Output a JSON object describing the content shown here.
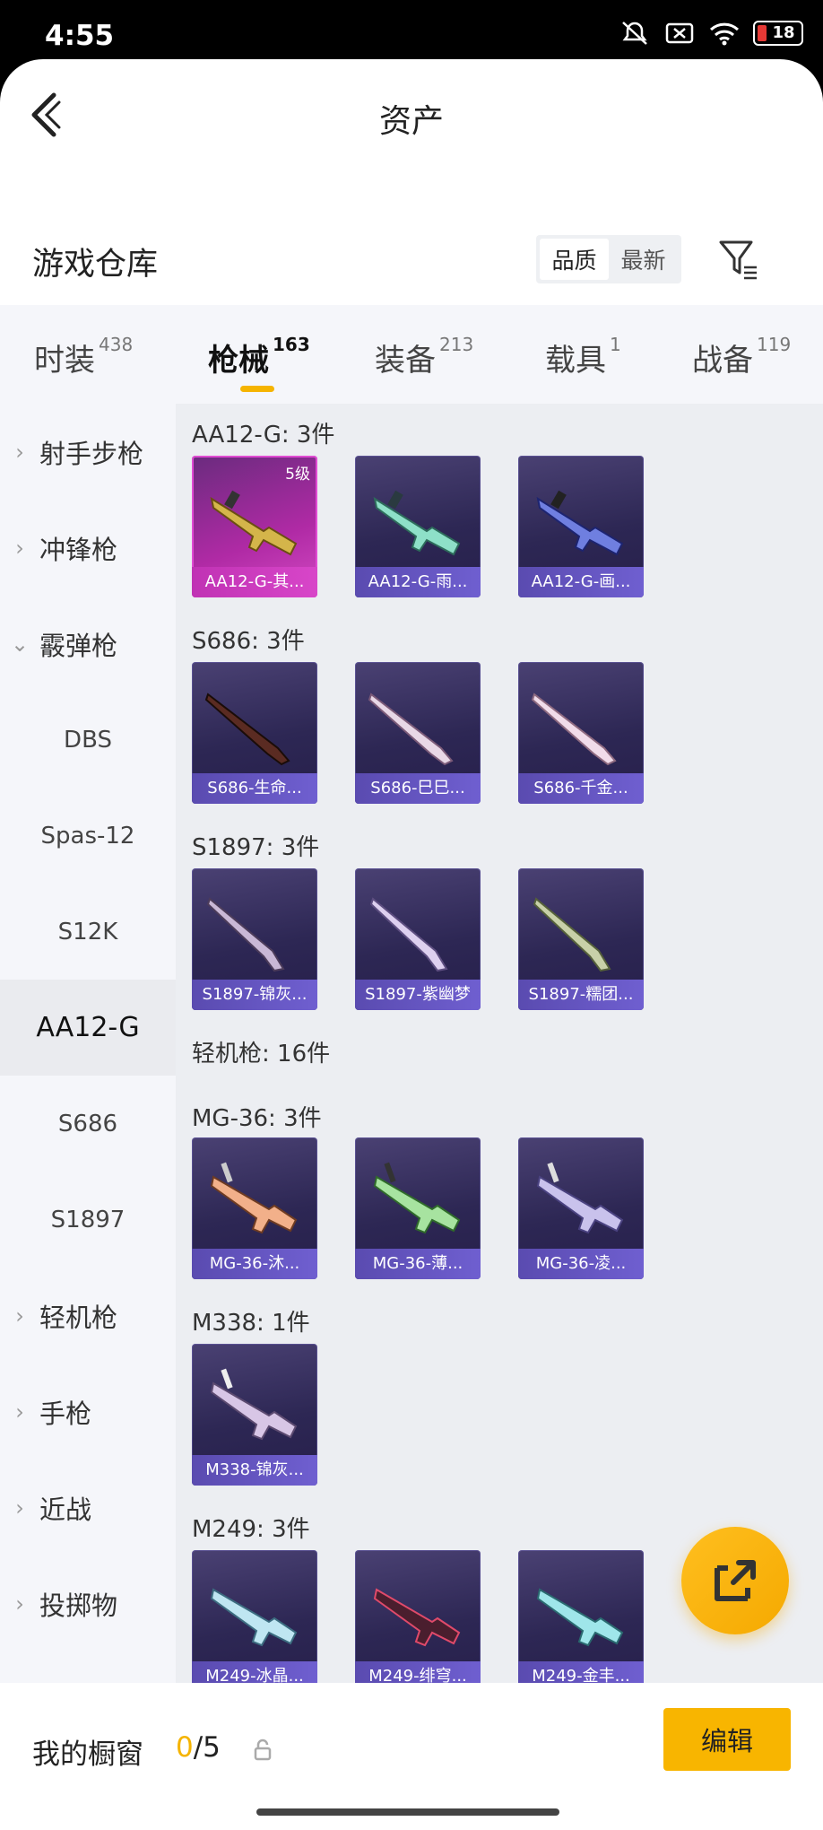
{
  "status_bar": {
    "time": "4:55",
    "battery": "18"
  },
  "header": {
    "title": "资产"
  },
  "warehouse": {
    "title": "游戏仓库",
    "sort_options": [
      "品质",
      "最新"
    ],
    "active_sort": "品质"
  },
  "tabs": [
    {
      "label": "时装",
      "count": "438"
    },
    {
      "label": "枪械",
      "count": "163",
      "active": true
    },
    {
      "label": "装备",
      "count": "213"
    },
    {
      "label": "载具",
      "count": "1"
    },
    {
      "label": "战备",
      "count": "119"
    }
  ],
  "sidebar": {
    "items": [
      {
        "label": "射手步枪"
      },
      {
        "label": "冲锋枪"
      },
      {
        "label": "霰弹枪"
      },
      {
        "label": "DBS"
      },
      {
        "label": "Spas-12"
      },
      {
        "label": "S12K"
      },
      {
        "label": "AA12-G"
      },
      {
        "label": "S686"
      },
      {
        "label": "S1897"
      },
      {
        "label": "轻机枪"
      },
      {
        "label": "手枪"
      },
      {
        "label": "近战"
      },
      {
        "label": "投掷物"
      }
    ]
  },
  "groups": [
    {
      "label": "AA12-G: 3件",
      "items": [
        {
          "name": "AA12-G-其...",
          "level": "5级"
        },
        {
          "name": "AA12-G-雨..."
        },
        {
          "name": "AA12-G-画..."
        }
      ]
    },
    {
      "label": "S686: 3件",
      "items": [
        {
          "name": "S686-生命..."
        },
        {
          "name": "S686-巳巳..."
        },
        {
          "name": "S686-千金..."
        }
      ]
    },
    {
      "label": "S1897: 3件",
      "items": [
        {
          "name": "S1897-锦灰..."
        },
        {
          "name": "S1897-紫幽梦"
        },
        {
          "name": "S1897-糯团..."
        }
      ]
    },
    {
      "label": "轻机枪: 16件",
      "items": []
    },
    {
      "label": "MG-36: 3件",
      "items": [
        {
          "name": "MG-36-沐..."
        },
        {
          "name": "MG-36-薄..."
        },
        {
          "name": "MG-36-凌..."
        }
      ]
    },
    {
      "label": "M338: 1件",
      "items": [
        {
          "name": "M338-锦灰..."
        }
      ]
    },
    {
      "label": "M249: 3件",
      "items": [
        {
          "name": "M249-冰晶..."
        },
        {
          "name": "M249-绯穹..."
        },
        {
          "name": "M249-金丰..."
        }
      ]
    }
  ],
  "bottom": {
    "window_label": "我的橱窗",
    "used": "0",
    "total": "/5",
    "edit_label": "编辑"
  },
  "colors": {
    "accent": "#f5b400",
    "card_bg": "#2d2754",
    "card_label": "#6f5fd0",
    "gold_card": "#d34ac3"
  }
}
